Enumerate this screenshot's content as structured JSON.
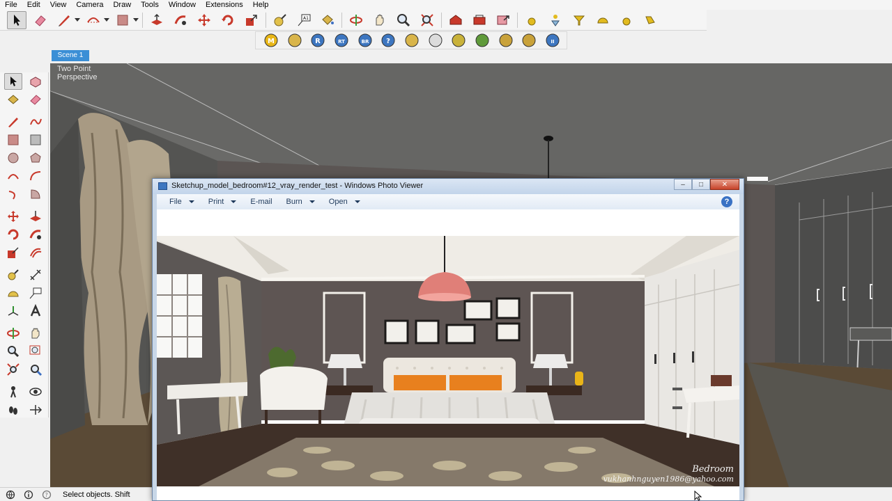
{
  "menu": [
    "File",
    "Edit",
    "View",
    "Camera",
    "Draw",
    "Tools",
    "Window",
    "Extensions",
    "Help"
  ],
  "toolbar1": {
    "groups": [
      [
        "select-arrow-icon"
      ],
      [
        "eraser-icon"
      ],
      [
        "pencil-line-icon"
      ],
      [
        "arc-icon"
      ],
      [
        "rectangle-icon"
      ],
      [
        "push-pull-icon",
        "follow-me-icon",
        "move-icon",
        "rotate-icon",
        "scale-icon"
      ],
      [
        "tape-measure-icon",
        "text-label-icon",
        "paint-bucket-icon"
      ],
      [
        "orbit-icon",
        "pan-icon",
        "zoom-icon",
        "zoom-extents-icon"
      ],
      [
        "warehouse-icon",
        "extension-warehouse-icon",
        "share-model-icon"
      ],
      [
        "sun-icon",
        "shadow-icon",
        "section-plane-icon",
        "dome-light-icon",
        "sphere-light-icon",
        "spot-light-icon"
      ]
    ]
  },
  "toolbar2": {
    "buttons": [
      {
        "name": "vray-material-editor-icon",
        "glyph": "M"
      },
      {
        "name": "vray-options-icon",
        "glyph": ""
      },
      {
        "name": "vray-render-icon",
        "glyph": "R"
      },
      {
        "name": "vray-rt-render-icon",
        "glyph": "RT"
      },
      {
        "name": "vray-batch-render-icon",
        "glyph": "BR"
      },
      {
        "name": "vray-help-icon",
        "glyph": "?"
      },
      {
        "name": "vray-frame-buffer-icon",
        "glyph": ""
      },
      {
        "name": "vray-sphere-light-icon",
        "glyph": ""
      },
      {
        "name": "vray-plane-light-icon",
        "glyph": ""
      },
      {
        "name": "vray-proxy-icon",
        "glyph": ""
      },
      {
        "name": "vray-infinite-plane-icon",
        "glyph": ""
      },
      {
        "name": "vray-mesh-light-icon",
        "glyph": ""
      },
      {
        "name": "vray-pause-icon",
        "glyph": "II"
      }
    ]
  },
  "scene_tab": "Scene 1",
  "viewport_label": "Two Point\nPerspective",
  "photo_viewer": {
    "title": "Sketchup_model_bedroom#12_vray_render_test - Windows Photo Viewer",
    "menu": [
      {
        "label": "File",
        "dropdown": true
      },
      {
        "label": "Print",
        "dropdown": true
      },
      {
        "label": "E-mail",
        "dropdown": false
      },
      {
        "label": "Burn",
        "dropdown": true
      },
      {
        "label": "Open",
        "dropdown": true
      }
    ],
    "help_glyph": "?",
    "caption_title": "Bedroom",
    "caption_email": "vukhanhnguyen1986@yahoo.com"
  },
  "status": {
    "text": "Select objects. Shift"
  },
  "colors": {
    "accent_blue": "#3b8fd6",
    "viewport_gray": "#6a6a68",
    "wall_taupe": "#5e5553",
    "pendant_coral": "#e07f78",
    "pillow_orange": "#e8801e"
  }
}
